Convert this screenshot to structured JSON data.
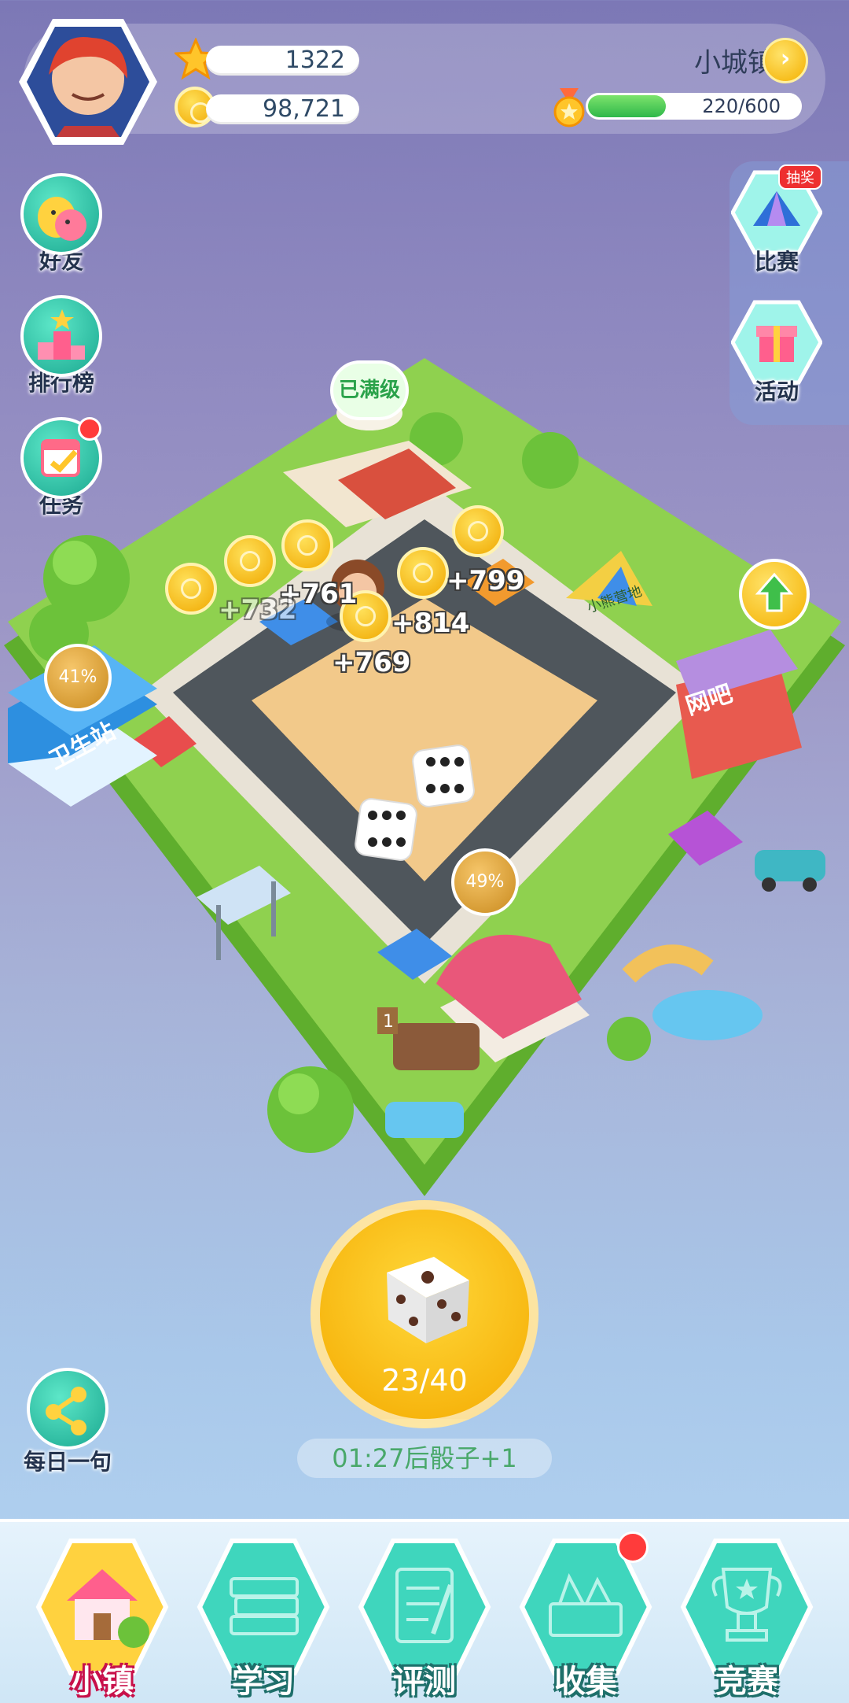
{
  "hud": {
    "stars": "1322",
    "coins": "98,721",
    "town_name": "小城镇",
    "town_arrow": "›",
    "level_text": "220/600",
    "level_progress": 0.367
  },
  "side_left": [
    {
      "label": "好友",
      "icon": "chicks-icon"
    },
    {
      "label": "排行榜",
      "icon": "podium-icon"
    },
    {
      "label": "任务",
      "icon": "calendar-check-icon"
    }
  ],
  "side_right": [
    {
      "label": "比赛",
      "icon": "tent-icon",
      "badge": "抽奖"
    },
    {
      "label": "活动",
      "icon": "gift-icon"
    }
  ],
  "board": {
    "maxed_label": "已满级",
    "gains": [
      "+761",
      "+732",
      "+799",
      "+814",
      "+769"
    ],
    "percent_left": "41%",
    "percent_bottom": "49%",
    "signs": {
      "clinic": "卫生站",
      "internet_cafe": "网吧",
      "tent_sign": "小熊营地",
      "plot_number": "1"
    }
  },
  "roll": {
    "count": "23/40",
    "timer": "01:27后骰子+1"
  },
  "share": {
    "label": "每日一句"
  },
  "nav": [
    {
      "label": "小镇",
      "active": true
    },
    {
      "label": "学习"
    },
    {
      "label": "评测"
    },
    {
      "label": "收集"
    },
    {
      "label": "竞赛"
    }
  ],
  "colors": {
    "accent_teal": "#1aa890",
    "gold": "#f4aa00",
    "grass": "#8fd14f",
    "road": "#4f565c",
    "sand": "#f2c98a"
  }
}
